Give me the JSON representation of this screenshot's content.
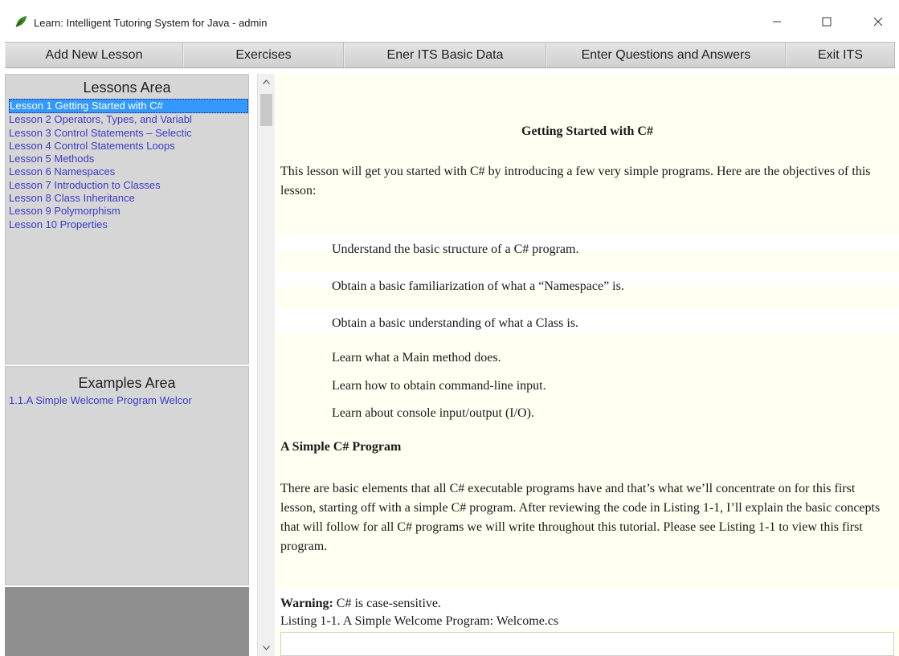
{
  "window": {
    "title": "Learn: Intelligent Tutoring System for Java  - admin",
    "icon": "leaf-app-icon",
    "controls": [
      "minimize-icon",
      "maximize-icon",
      "close-icon"
    ]
  },
  "toolbar": {
    "add_lesson": "Add New Lesson",
    "exercises": "Exercises",
    "basic_data": "Ener ITS Basic Data",
    "questions": "Enter Questions and Answers",
    "exit": "Exit ITS"
  },
  "lessons_area": {
    "title": "Lessons  Area",
    "items": [
      "Lesson 1 Getting Started with C#",
      "Lesson 2 Operators, Types, and Variabl",
      "Lesson 3 Control Statements – Selectic",
      "Lesson 4 Control Statements Loops",
      "Lesson 5  Methods",
      "Lesson 6 Namespaces",
      "Lesson 7 Introduction to Classes",
      "Lesson 8 Class Inheritance",
      "Lesson 9 Polymorphism",
      "Lesson 10 Properties"
    ],
    "selected_index": 0
  },
  "examples_area": {
    "title": "Examples  Area",
    "items": [
      "1.1.A Simple Welcome Program Welcor"
    ]
  },
  "content": {
    "heading": "Getting Started with C#",
    "intro": "This lesson will get you started with C# by introducing a few very simple programs. Here are the objectives of this lesson:",
    "objectives": [
      "Understand the basic structure of a C# program.",
      "Obtain a basic familiarization of what a “Namespace” is.",
      "Obtain a basic understanding of what a Class is.",
      "Learn what a Main method does.",
      "Learn how to obtain command-line input.",
      "Learn about console input/output (I/O)."
    ],
    "section_title": "A Simple C# Program",
    "section_body": "There are basic elements that all C# executable programs have and that’s what we’ll concentrate on for this first lesson, starting off with a simple C# program. After reviewing the code in Listing 1-1, I’ll explain the basic concepts that will follow for all C# programs we will write throughout this tutorial. Please see Listing 1-1 to view this first program.",
    "warning_label": "Warning:",
    "warning_text": " C# is case-sensitive.",
    "listing_caption": "Listing 1-1. A Simple Welcome Program: Welcome.cs"
  },
  "colors": {
    "toolbar": "#d4d4d4",
    "panel": "#d6d6d6",
    "link": "#3b3bc7",
    "selected": "#3399ff",
    "content_bg": "#fffff2"
  }
}
